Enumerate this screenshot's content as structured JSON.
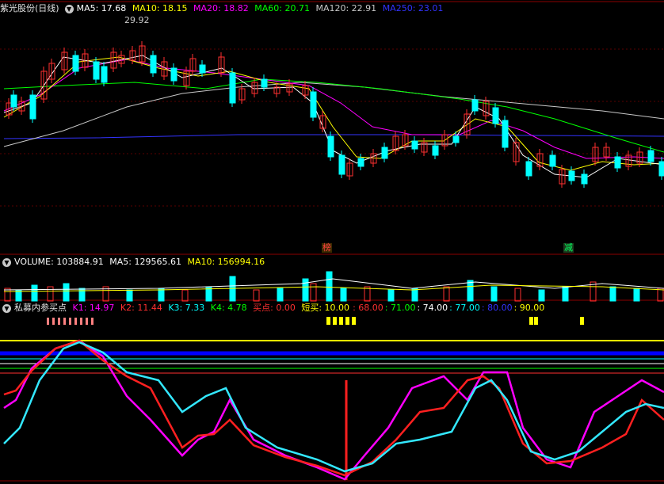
{
  "price_panel": {
    "stock_name": "紫光股份(日线)",
    "ma": [
      {
        "label": "MA5: 17.68",
        "color": "#ffffff"
      },
      {
        "label": "MA10: 18.15",
        "color": "#ffff00"
      },
      {
        "label": "MA20: 18.82",
        "color": "#ff00ff"
      },
      {
        "label": "MA60: 20.71",
        "color": "#00ff00"
      },
      {
        "label": "MA120: 22.91",
        "color": "#c8c8c8"
      },
      {
        "label": "MA250: 23.01",
        "color": "#3333ff"
      }
    ],
    "high_label": "29.92",
    "markers": [
      {
        "text": "榜",
        "color": "#ff4040"
      },
      {
        "text": "减",
        "color": "#00ff60"
      }
    ]
  },
  "volume_panel": {
    "items": [
      {
        "label": "VOLUME: 103884.91",
        "color": "#ffffff"
      },
      {
        "label": "MA5: 129565.61",
        "color": "#ffffff"
      },
      {
        "label": "MA10: 156994.16",
        "color": "#ffff00"
      }
    ]
  },
  "indicator_panel": {
    "name": "私募内参买点",
    "items": [
      {
        "label": "K1: 14.97",
        "color": "#ff00ff"
      },
      {
        "label": "K2: 11.44",
        "color": "#ff3030"
      },
      {
        "label": "K3: 7.33",
        "color": "#00ffff"
      },
      {
        "label": "K4: 4.78",
        "color": "#00ff00"
      },
      {
        "label": "买点: 0.00",
        "color": "#ff3030"
      },
      {
        "label": "短买: 10.00",
        "color": "#ffff00"
      },
      {
        "label": ": 68.00",
        "color": "#ff3030"
      },
      {
        "label": ": 71.00",
        "color": "#00ff00"
      },
      {
        "label": ": 74.00",
        "color": "#ffffff"
      },
      {
        "label": ": 77.00",
        "color": "#00ffff"
      },
      {
        "label": ": 80.00",
        "color": "#3333ff"
      },
      {
        "label": ": 90.00",
        "color": "#ffff00"
      }
    ]
  },
  "colors": {
    "up": "#ff3030",
    "down": "#00ffff",
    "grid": "#8b0000"
  }
}
